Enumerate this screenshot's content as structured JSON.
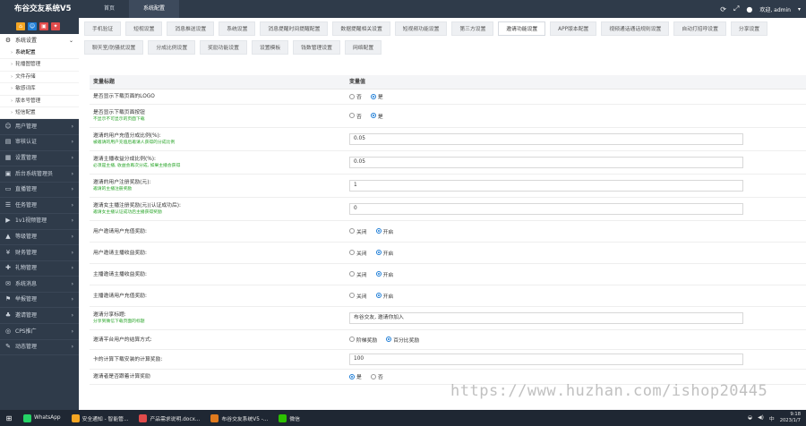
{
  "app": {
    "title": "布谷交友系统V5",
    "user_label": "欢迎, admin",
    "top_nav": [
      {
        "label": "首页",
        "active": false
      },
      {
        "label": "系统配置",
        "active": true
      }
    ]
  },
  "sidebar": {
    "quick_colors": [
      "#f5a623",
      "#1e7dd6",
      "#e04b4b",
      "#e04b4b"
    ],
    "open_group": "系统设置",
    "sub_items": [
      {
        "label": "系统配置",
        "active": true
      },
      {
        "label": "轮播图管理",
        "active": false
      },
      {
        "label": "文件存储",
        "active": false
      },
      {
        "label": "敏感词库",
        "active": false
      },
      {
        "label": "版本号管理",
        "active": false
      },
      {
        "label": "短信配置",
        "active": false
      }
    ],
    "groups": [
      {
        "label": "用户管理",
        "icon": "user-icon"
      },
      {
        "label": "审核认证",
        "icon": "id-card-icon"
      },
      {
        "label": "设置管理",
        "icon": "settings-icon"
      },
      {
        "label": "后台系统管理员",
        "icon": "admin-icon"
      },
      {
        "label": "直播管理",
        "icon": "live-icon"
      },
      {
        "label": "任务管理",
        "icon": "task-icon"
      },
      {
        "label": "1v1视频管理",
        "icon": "video-icon"
      },
      {
        "label": "等级管理",
        "icon": "level-icon"
      },
      {
        "label": "财务管理",
        "icon": "finance-icon"
      },
      {
        "label": "礼物管理",
        "icon": "gift-icon"
      },
      {
        "label": "系统消息",
        "icon": "message-icon"
      },
      {
        "label": "举报管理",
        "icon": "report-icon"
      },
      {
        "label": "邀请管理",
        "icon": "invite-icon"
      },
      {
        "label": "CPS推广",
        "icon": "cps-icon"
      },
      {
        "label": "动态管理",
        "icon": "dynamic-icon"
      }
    ]
  },
  "tabs": [
    {
      "label": "手机验证",
      "active": false
    },
    {
      "label": "短视设置",
      "active": false
    },
    {
      "label": "消息推送设置",
      "active": false
    },
    {
      "label": "系统设置",
      "active": false
    },
    {
      "label": "消息提醒时间提醒配置",
      "active": false
    },
    {
      "label": "数据提醒相关设置",
      "active": false
    },
    {
      "label": "短视频功能设置",
      "active": false
    },
    {
      "label": "第三方设置",
      "active": false
    },
    {
      "label": "邀请功能设置",
      "active": true
    },
    {
      "label": "APP版本配置",
      "active": false
    },
    {
      "label": "视频通话通话规则设置",
      "active": false
    },
    {
      "label": "自动打招呼设置",
      "active": false
    },
    {
      "label": "分享设置",
      "active": false
    },
    {
      "label": "聊天室/防骚扰设置",
      "active": false
    },
    {
      "label": "分成比例设置",
      "active": false
    },
    {
      "label": "奖励功能设置",
      "active": false
    },
    {
      "label": "设置模板",
      "active": false
    },
    {
      "label": "钱数管理设置",
      "active": false
    },
    {
      "label": "网络配置",
      "active": false
    }
  ],
  "table": {
    "col_name": "变量标题",
    "col_value": "变量值",
    "rows": [
      {
        "label": "是否显示下载页面的LOGO",
        "hint": "",
        "type": "radio",
        "options": [
          "否",
          "是"
        ],
        "selected": 1
      },
      {
        "label": "是否显示下载页面按钮",
        "hint": "不显示不可显示的页面下载",
        "type": "radio",
        "options": [
          "否",
          "是"
        ],
        "selected": 1
      },
      {
        "label": "邀请的用户充值分成比例(%):",
        "hint": "被邀请的用户充值后邀请人获得的分成比例",
        "type": "input",
        "value": "0.05"
      },
      {
        "label": "邀请主播收益分成比例(%):",
        "hint": "必须是主播, 收益会再次分成, 如果主播会获得",
        "type": "input",
        "value": "0.05"
      },
      {
        "label": "邀请的用户注册奖励(元):",
        "hint": "邀请的主播注册奖励",
        "type": "input",
        "value": "1"
      },
      {
        "label": "邀请女主播注册奖励(元)(认证成功后):",
        "hint": "邀请女主播认证成功后主播获得奖励",
        "type": "input",
        "value": "0"
      },
      {
        "label": "用户邀请用户充值奖励:",
        "hint": "",
        "type": "radio",
        "options": [
          "关闭",
          "开启"
        ],
        "selected": 1
      },
      {
        "label": "用户邀请主播收益奖励:",
        "hint": "",
        "type": "radio",
        "options": [
          "关闭",
          "开启"
        ],
        "selected": 1
      },
      {
        "label": "主播邀请主播收益奖励:",
        "hint": "",
        "type": "radio",
        "options": [
          "关闭",
          "开启"
        ],
        "selected": 1
      },
      {
        "label": "主播邀请用户充值奖励:",
        "hint": "",
        "type": "radio",
        "options": [
          "关闭",
          "开启"
        ],
        "selected": 1
      },
      {
        "label": "邀请分享标题:",
        "hint": "分享到微信下载页面的标题",
        "type": "input",
        "value": "布谷交友, 邀请你加入"
      },
      {
        "label": "邀请平台用户的结算方式:",
        "hint": "",
        "type": "radio",
        "options": [
          "阶梯奖励",
          "百分比奖励"
        ],
        "selected": 1
      },
      {
        "label": "卡的计算下载安装的计算奖励:",
        "hint": "",
        "type": "input",
        "value": "100"
      },
      {
        "label": "邀请者是否跟着计算奖励",
        "hint": "",
        "type": "radio",
        "options": [
          "是",
          "否"
        ],
        "selected": 0
      }
    ]
  },
  "watermark": "https://www.huzhan.com/ishop20445",
  "taskbar": {
    "items": [
      {
        "label": "WhatsApp",
        "color": "#25d366",
        "active": false
      },
      {
        "label": "安全通知 - 智能管...",
        "color": "#f5a623",
        "active": false
      },
      {
        "label": "产品需求说明.docx...",
        "color": "#e04b4b",
        "active": false
      },
      {
        "label": "布谷交友系统V5 -...",
        "color": "#e07a1e",
        "active": false
      },
      {
        "label": "微信",
        "color": "#2dc100",
        "active": false
      }
    ],
    "time": "9:18",
    "date": "2023/1/7"
  }
}
